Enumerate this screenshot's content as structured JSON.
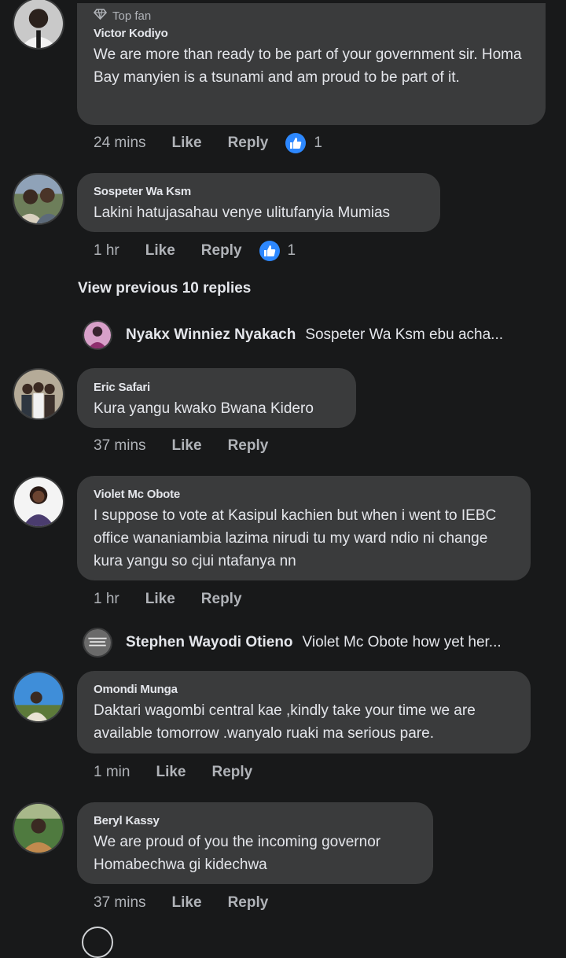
{
  "colors": {
    "background": "#18191a",
    "bubble": "#3a3b3c",
    "text": "#e4e6eb",
    "secondary": "#b0b3b8",
    "accent": "#2d88ff"
  },
  "comments": [
    {
      "badge": "Top fan",
      "badge_icon": "diamond-icon",
      "author": "Victor Kodiyo",
      "text": "We are more than ready to be part of your government sir. Homa Bay manyien is a tsunami and am proud to be part of it.",
      "time": "24 mins",
      "like_label": "Like",
      "reply_label": "Reply",
      "reaction_count": "1"
    },
    {
      "author": "Sospeter Wa Ksm",
      "text": "Lakini hatujasahau venye ulitufanyia Mumias",
      "time": "1 hr",
      "like_label": "Like",
      "reply_label": "Reply",
      "reaction_count": "1"
    },
    {
      "author": "Eric Safari",
      "text": "Kura yangu kwako  Bwana Kidero",
      "time": "37 mins",
      "like_label": "Like",
      "reply_label": "Reply"
    },
    {
      "author": "Violet Mc Obote",
      "text": "I suppose to vote at Kasipul  kachien but when i went to IEBC office wananiambia lazima nirudi tu my ward ndio ni change kura yangu so cjui ntafanya nn",
      "time": "1 hr",
      "like_label": "Like",
      "reply_label": "Reply"
    },
    {
      "author": "Omondi Munga",
      "text": "Daktari wagombi central kae ,kindly take your time we are available tomorrow .wanyalo ruaki ma serious pare.",
      "time": "1 min",
      "like_label": "Like",
      "reply_label": "Reply"
    },
    {
      "author": "Beryl Kassy",
      "text": "We are proud of you the incoming governor Homabechwa gi kidechwa",
      "time": "37 mins",
      "like_label": "Like",
      "reply_label": "Reply"
    }
  ],
  "view_previous_label": "View previous 10 replies",
  "collapsed_replies": [
    {
      "name": "Nyakx Winniez Nyakach",
      "preview": "Sospeter Wa Ksm ebu acha..."
    },
    {
      "name": "Stephen Wayodi Otieno",
      "preview": "Violet Mc Obote how yet her..."
    }
  ]
}
